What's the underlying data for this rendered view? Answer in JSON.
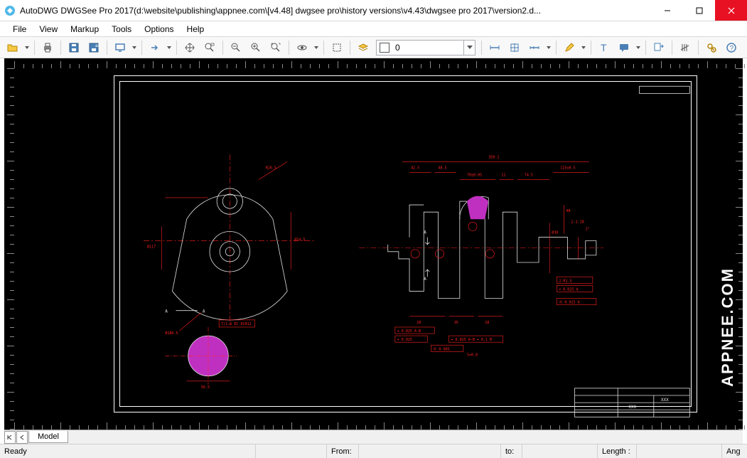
{
  "window": {
    "title": "AutoDWG DWGSee Pro 2017(d:\\website\\publishing\\appnee.com\\[v4.48] dwgsee pro\\history versions\\v4.43\\dwgsee pro 2017\\version2.d..."
  },
  "menu": {
    "items": [
      "File",
      "View",
      "Markup",
      "Tools",
      "Options",
      "Help"
    ]
  },
  "toolbar": {
    "layer_value": "0"
  },
  "tabs": {
    "active": "Model"
  },
  "status": {
    "ready": "Ready",
    "from_label": "From:",
    "to_label": "to:",
    "length_label": "Length :",
    "angle_label": "Ang"
  },
  "drawing": {
    "section_label_A": "A",
    "section_label_A2": "A",
    "title_block_name": "XXX",
    "title_block_name2": "XXX"
  },
  "watermark": "APPNEE.COM"
}
